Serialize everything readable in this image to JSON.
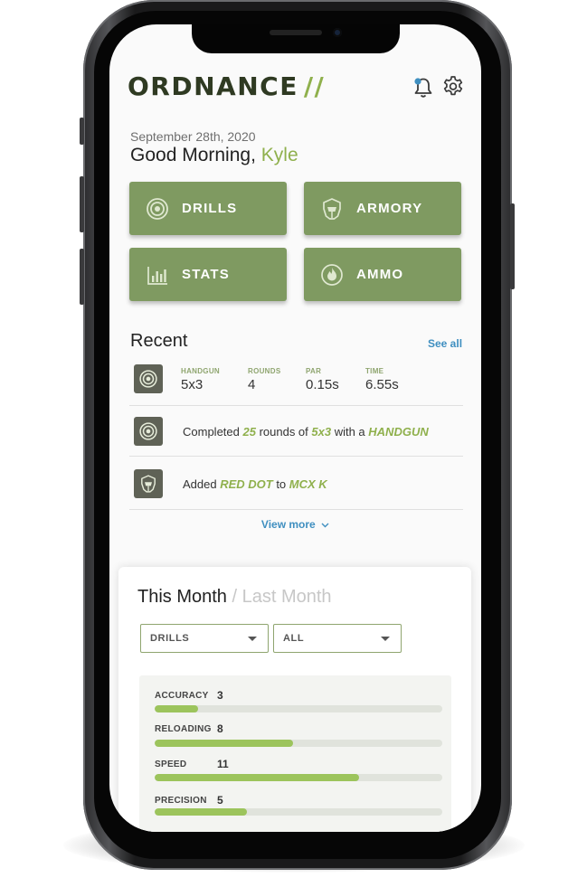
{
  "app": {
    "logo_text": "ORDNANCE",
    "logo_slash": "//",
    "accent_color": "#8fb04c",
    "tile_color": "#7f9a61",
    "link_color": "#3f8fc0",
    "notification_icon": "bell-icon",
    "settings_icon": "gear-icon"
  },
  "header": {
    "date": "September 28th, 2020",
    "greeting_prefix": "Good Morning,",
    "user_name": "Kyle"
  },
  "tiles": [
    {
      "label": "DRILLS",
      "icon": "target-icon"
    },
    {
      "label": "ARMORY",
      "icon": "helmet-icon"
    },
    {
      "label": "STATS",
      "icon": "bar-chart-icon"
    },
    {
      "label": "AMMO",
      "icon": "flame-icon"
    }
  ],
  "recent": {
    "title": "Recent",
    "see_all": "See all",
    "stat_row": {
      "icon": "target-icon",
      "stats": [
        {
          "label": "HANDGUN",
          "value": "5x3"
        },
        {
          "label": "ROUNDS",
          "value": "4"
        },
        {
          "label": "PAR",
          "value": "0.15s"
        },
        {
          "label": "TIME",
          "value": "6.55s"
        }
      ]
    },
    "activity_1": {
      "icon": "target-icon",
      "t1": "Completed ",
      "rounds": "25",
      "t2": " rounds of ",
      "drill": "5x3",
      "t3": " with a ",
      "weapon": "HANDGUN"
    },
    "activity_2": {
      "icon": "helmet-icon",
      "t1": "Added ",
      "item": "RED DOT",
      "t2": " to ",
      "target": "MCX K"
    },
    "view_more": "View more"
  },
  "month_card": {
    "title_active": "This Month",
    "separator": " / ",
    "title_inactive": "Last Month",
    "select_1": "DRILLS",
    "select_2": "ALL",
    "metrics": [
      {
        "label": "ACCURACY",
        "value": "3",
        "fill": 0.15
      },
      {
        "label": "RELOADING",
        "value": "8",
        "fill": 0.48
      },
      {
        "label": "SPEED",
        "value": "11",
        "fill": 0.71
      },
      {
        "label": "PRECISION",
        "value": "5",
        "fill": 0.32
      }
    ]
  }
}
